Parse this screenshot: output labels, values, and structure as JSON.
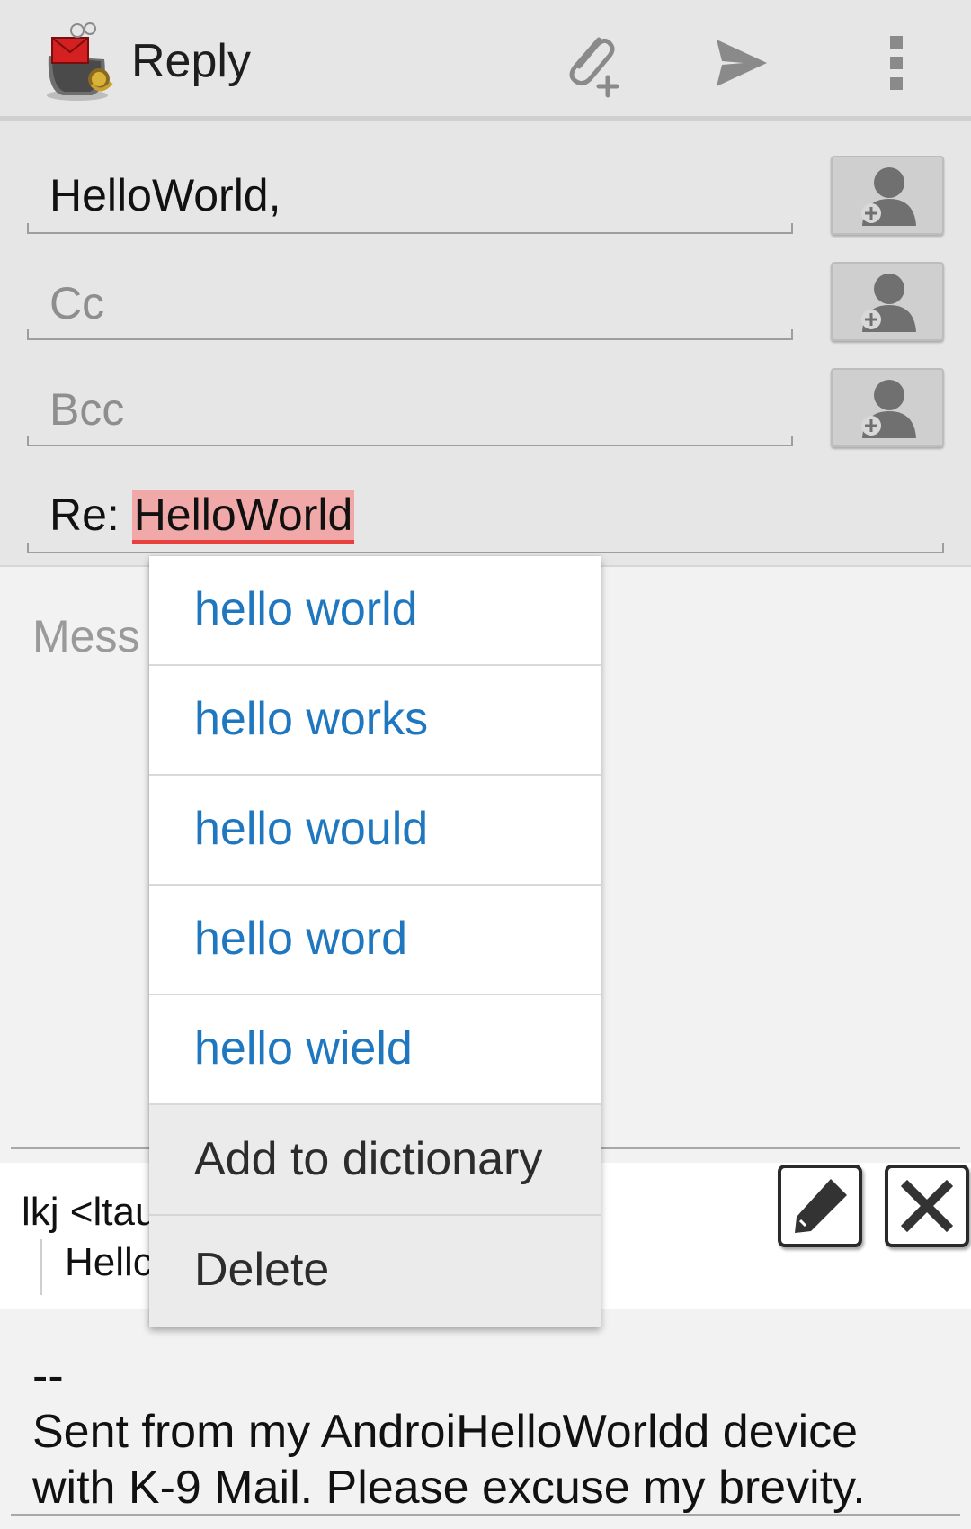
{
  "actionbar": {
    "title": "Reply",
    "icons": [
      "k9-mail-app-icon",
      "attach-icon",
      "send-icon",
      "overflow-menu-icon"
    ]
  },
  "recipients": {
    "to_value": "HelloWorld,",
    "cc_placeholder": "Cc",
    "bcc_placeholder": "Bcc",
    "contact_button_icon": "add-contact-icon"
  },
  "subject": {
    "prefix": "Re: ",
    "misspelled_word": "HelloWorld"
  },
  "message": {
    "placeholder_visible": "Mess"
  },
  "quoted": {
    "header_visible": "lkj <ltau",
    "header_end_visible": ":",
    "body_visible": "Hellc",
    "edit_icon": "pencil-icon",
    "delete_icon": "close-x-icon"
  },
  "signature": {
    "text": "--\nSent from my AndroiHelloWorldd device\nwith K-9 Mail. Please excuse my brevity."
  },
  "spell_popup": {
    "suggestions": [
      "hello world",
      "hello works",
      "hello would",
      "hello word",
      "hello wield"
    ],
    "add_to_dictionary": "Add to dictionary",
    "delete": "Delete"
  },
  "colors": {
    "suggestion_text": "#1f77bf",
    "misspelled_highlight": "#f0a8a8",
    "misspelled_underline": "#e8413d",
    "actionbar_bg": "#e6e6e6"
  }
}
